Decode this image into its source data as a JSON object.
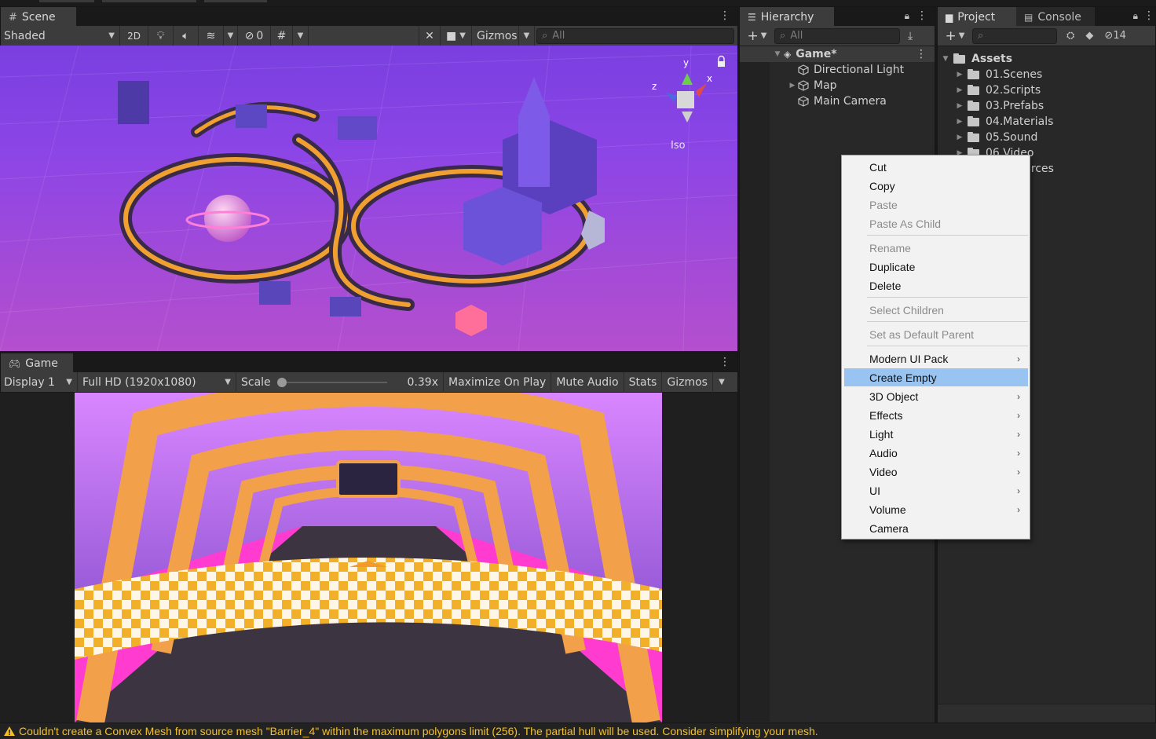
{
  "scene": {
    "tab_label": "Scene",
    "shading_mode": "Shaded",
    "toggle_2d": "2D",
    "hidden_count": "0",
    "gizmos_label": "Gizmos",
    "search_placeholder": "All",
    "gizmo_axes": {
      "y": "y",
      "x": "x",
      "z": "z"
    },
    "projection_label": "Iso"
  },
  "game": {
    "tab_label": "Game",
    "display": "Display 1",
    "resolution": "Full HD (1920x1080)",
    "scale_label": "Scale",
    "scale_value": "0.39x",
    "scale_fraction": 0.0,
    "maximize_on_play": "Maximize On Play",
    "mute_audio": "Mute Audio",
    "stats": "Stats",
    "gizmos": "Gizmos"
  },
  "hierarchy": {
    "tab_label": "Hierarchy",
    "search_placeholder": "All",
    "scene_name": "Game*",
    "items": [
      "Directional Light",
      "Map",
      "Main Camera"
    ]
  },
  "project": {
    "tab_label": "Project",
    "console_tab_label": "Console",
    "hidden_count": "14",
    "root": "Assets",
    "folders": [
      "01.Scenes",
      "02.Scripts",
      "03.Prefabs",
      "04.Materials",
      "05.Sound",
      "06.Video"
    ],
    "partial_folder_suffix": "urces"
  },
  "context_menu": {
    "items": [
      {
        "label": "Cut",
        "enabled": true
      },
      {
        "label": "Copy",
        "enabled": true
      },
      {
        "label": "Paste",
        "enabled": false
      },
      {
        "label": "Paste As Child",
        "enabled": false
      },
      {
        "label": "Rename",
        "enabled": false
      },
      {
        "label": "Duplicate",
        "enabled": true
      },
      {
        "label": "Delete",
        "enabled": true
      },
      {
        "label": "Select Children",
        "enabled": false
      },
      {
        "label": "Set as Default Parent",
        "enabled": false
      },
      {
        "label": "Modern UI Pack",
        "enabled": true,
        "submenu": true
      },
      {
        "label": "Create Empty",
        "enabled": true,
        "selected": true
      },
      {
        "label": "3D Object",
        "enabled": true,
        "submenu": true
      },
      {
        "label": "Effects",
        "enabled": true,
        "submenu": true
      },
      {
        "label": "Light",
        "enabled": true,
        "submenu": true
      },
      {
        "label": "Audio",
        "enabled": true,
        "submenu": true
      },
      {
        "label": "Video",
        "enabled": true,
        "submenu": true
      },
      {
        "label": "UI",
        "enabled": true,
        "submenu": true
      },
      {
        "label": "Volume",
        "enabled": true,
        "submenu": true
      },
      {
        "label": "Camera",
        "enabled": true
      }
    ]
  },
  "status": {
    "message": "Couldn't create a Convex Mesh from source mesh \"Barrier_4\" within the maximum polygons limit (256). The partial hull will be used. Consider simplifying your mesh."
  },
  "colors": {
    "menu_highlight": "#99c3f0",
    "warning": "#f4c02a",
    "scene_sky": "#8c45e6"
  }
}
